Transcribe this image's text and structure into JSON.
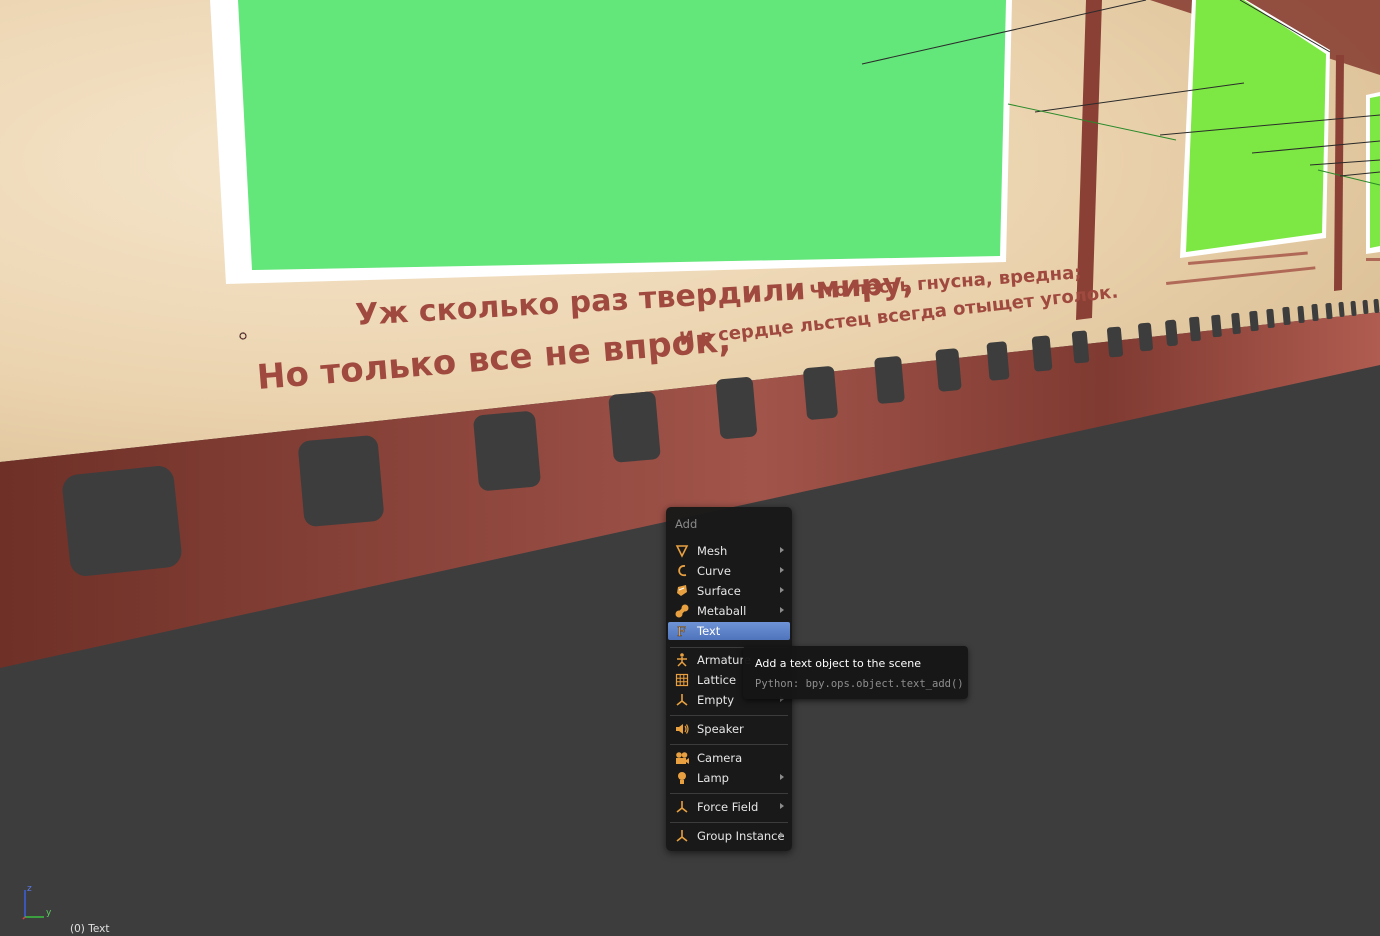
{
  "scene": {
    "poem_line_1a": "Уж сколько раз твердили миру,",
    "poem_line_1b": "Что лесть гнусна, вредна;",
    "poem_line_2a": "Но только все не впрок,",
    "poem_line_2b": "И в сердце льстец всегда отыщет уголок."
  },
  "menu": {
    "title": "Add",
    "items": [
      {
        "label": "Mesh",
        "icon": "mesh-icon",
        "submenu": true
      },
      {
        "label": "Curve",
        "icon": "curve-icon",
        "submenu": true
      },
      {
        "label": "Surface",
        "icon": "surface-icon",
        "submenu": true
      },
      {
        "label": "Metaball",
        "icon": "metaball-icon",
        "submenu": true
      },
      {
        "label": "Text",
        "icon": "text-icon",
        "submenu": false,
        "active": true
      },
      {
        "label": "Armature",
        "icon": "armature-icon",
        "submenu": false
      },
      {
        "label": "Lattice",
        "icon": "lattice-icon",
        "submenu": false
      },
      {
        "label": "Empty",
        "icon": "empty-icon",
        "submenu": true
      },
      {
        "label": "Speaker",
        "icon": "speaker-icon",
        "submenu": false
      },
      {
        "label": "Camera",
        "icon": "camera-icon",
        "submenu": false
      },
      {
        "label": "Lamp",
        "icon": "lamp-icon",
        "submenu": true
      },
      {
        "label": "Force Field",
        "icon": "force-field-icon",
        "submenu": true
      },
      {
        "label": "Group Instance",
        "icon": "group-instance-icon",
        "submenu": true
      }
    ]
  },
  "tooltip": {
    "description": "Add a text object to the scene",
    "python": "Python: bpy.ops.object.text_add()"
  },
  "status": {
    "object_info": "(0) Text"
  },
  "gizmo": {
    "z_label": "z",
    "y_label": "y"
  },
  "colors": {
    "accent_active": "#5b80c8",
    "icon_orange": "#e8a040",
    "wall_beige": "#efd9b6",
    "film_red": "#8a3f35",
    "screen_green": "#63e67a"
  }
}
